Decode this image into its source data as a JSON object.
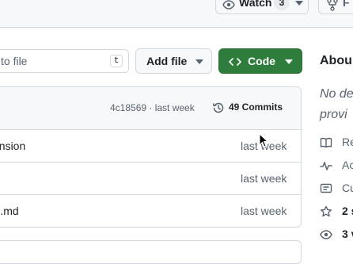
{
  "header": {
    "watch": {
      "label": "Watch",
      "count": "3"
    },
    "fork": {
      "label": "F"
    }
  },
  "toolbar": {
    "go_to_file_placeholder": "to file",
    "go_to_file_shortcut": "t",
    "add_file_label": "Add file",
    "code_label": "Code"
  },
  "latest_commit": {
    "hash_time": "4c18569 · last week",
    "commits_label": "49 Commits"
  },
  "files": [
    {
      "name": "ension",
      "time": "last week"
    },
    {
      "name": "",
      "time": "last week"
    },
    {
      "name": "E.md",
      "time": "last week"
    }
  ],
  "about": {
    "title": "Abou",
    "desc_line1": "No de",
    "desc_line2": "provi",
    "items": [
      {
        "icon": "book-icon",
        "label": "Re"
      },
      {
        "icon": "pulse-icon",
        "label": "Ac"
      },
      {
        "icon": "comment-icon",
        "label": "Cu"
      },
      {
        "icon": "star-icon",
        "label": "2 s"
      },
      {
        "icon": "eye-icon",
        "label": "3 v"
      }
    ]
  },
  "colors": {
    "primary_green": "#2f7d3c",
    "border": "#d1d9e0",
    "muted_text": "#59636e",
    "header_bg": "#f6f8fa"
  }
}
